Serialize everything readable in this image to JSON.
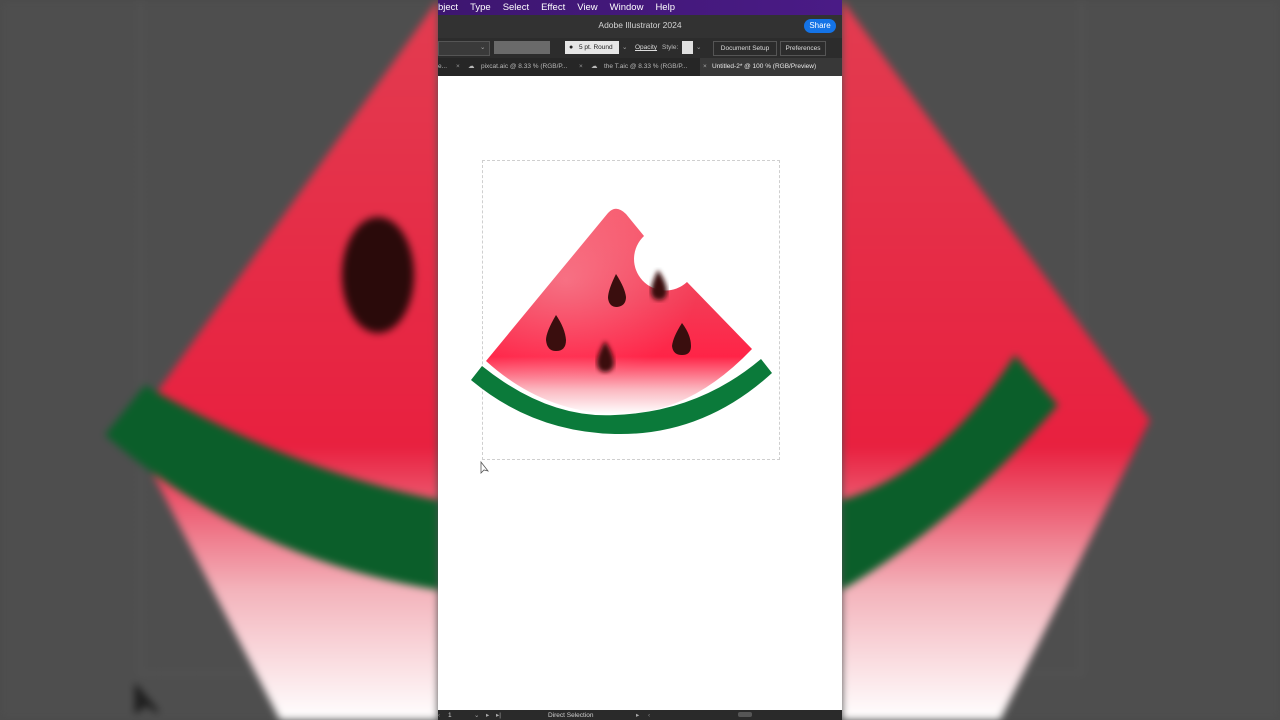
{
  "menu": [
    "bject",
    "Type",
    "Select",
    "Effect",
    "View",
    "Window",
    "Help"
  ],
  "app_title": "Adobe Illustrator 2024",
  "share_label": "Share",
  "control_bar": {
    "stroke_profile": "5 pt. Round",
    "opacity_label": "Opacity",
    "style_label": "Style:",
    "document_setup": "Document Setup",
    "preferences": "Preferences"
  },
  "tabs": [
    {
      "label": "pixcat.aic @ 8.33 % (RGB/P..."
    },
    {
      "label": "the T.aic @ 8.33 % (RGB/P..."
    },
    {
      "label": "Untitled-2* @ 100 % (RGB/Preview)"
    }
  ],
  "status": {
    "artboard_number": "1",
    "tool": "Direct Selection"
  },
  "colors": {
    "rind": "#0b7a3a",
    "flesh": "#ff3250",
    "seed": "#3a0e0e",
    "menubar": "#4a1b86",
    "share": "#1473e6"
  }
}
